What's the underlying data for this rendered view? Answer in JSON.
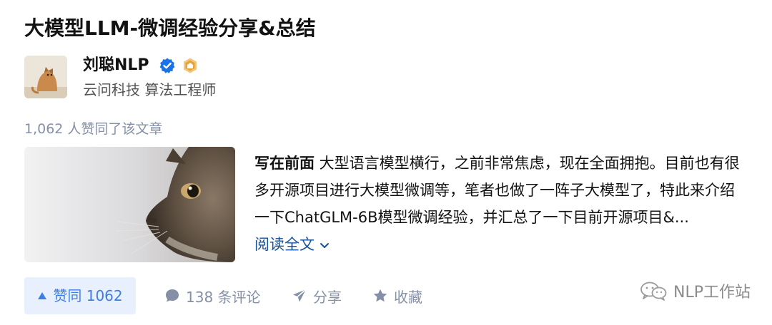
{
  "article": {
    "title": "大模型LLM-微调经验分享&总结",
    "author": {
      "name": "刘聪NLP",
      "bio": "云问科技 算法工程师",
      "badges": [
        "verified-icon",
        "level-badge-icon"
      ]
    },
    "likes_line": "1,062 人赞同了该文章",
    "excerpt": {
      "lead": "写在前面",
      "body": " 大型语言模型横行，之前非常焦虑，现在全面拥抱。目前也有很多开源项目进行大模型微调等，笔者也做了一阵子大模型了，特此来介绍一下ChatGLM-6B模型微调经验，并汇总了一下目前开源项目&...",
      "read_more": "阅读全文"
    }
  },
  "actions": {
    "vote_label": "赞同 1062",
    "comments_label": "138 条评论",
    "share_label": "分享",
    "favorite_label": "收藏"
  },
  "watermark": "NLP工作站",
  "colors": {
    "link": "#175199",
    "vote_text": "#3e7de3",
    "vote_bg": "#e8f0fd",
    "muted": "#8590a6",
    "verified": "#1a73e8",
    "level_badge": "#e6a23c"
  }
}
